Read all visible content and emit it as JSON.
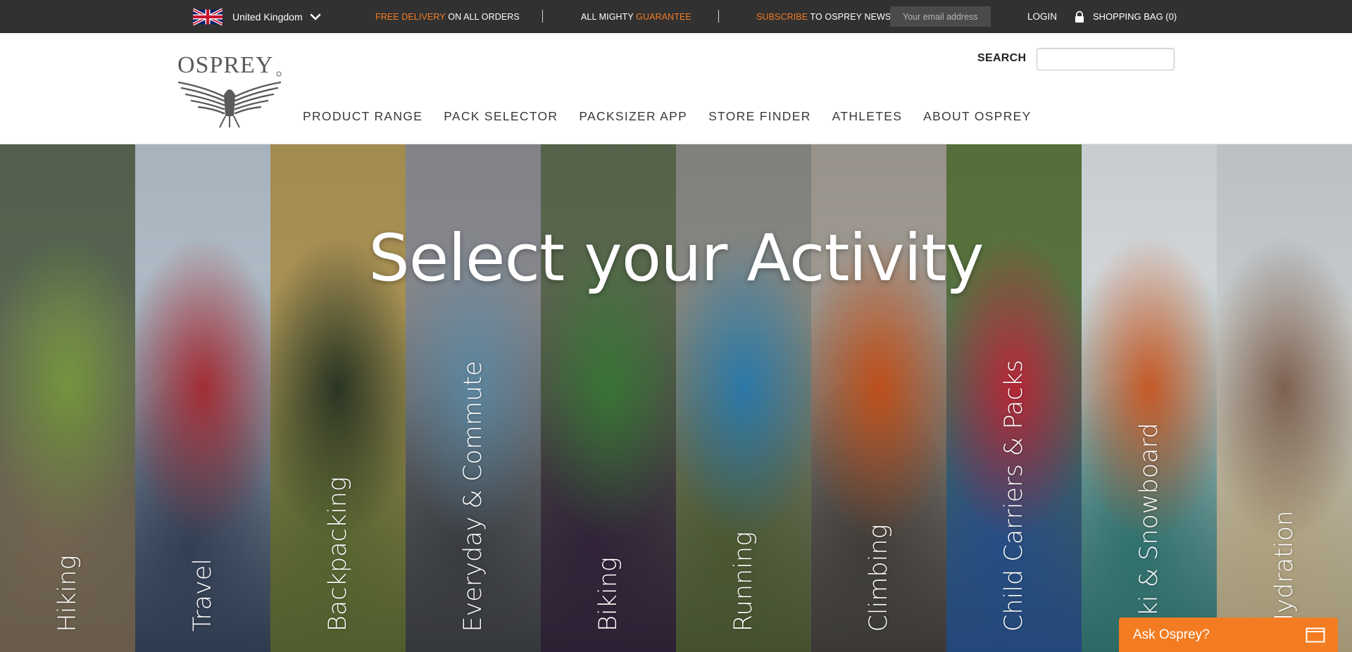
{
  "topbar": {
    "country": "United Kingdom",
    "promo1_highlight": "FREE DELIVERY",
    "promo1_rest": " ON ALL ORDERS",
    "promo2_text": "ALL MIGHTY ",
    "promo2_highlight": "GUARANTEE",
    "promo3_highlight": "SUBSCRIBE",
    "promo3_rest": " TO OSPREY NEWS",
    "email_placeholder": "Your email address",
    "login": "LOGIN",
    "bag": "SHOPPING BAG (0)"
  },
  "header": {
    "search_label": "SEARCH",
    "nav": [
      "PRODUCT RANGE",
      "PACK SELECTOR",
      "PACKSIZER APP",
      "STORE FINDER",
      "ATHLETES",
      "ABOUT OSPREY"
    ]
  },
  "hero": {
    "title": "Select your Activity",
    "activities": [
      {
        "label": "Hiking",
        "c1": "#5b6a55",
        "c2": "#7fa344",
        "c3": "#8c7a63"
      },
      {
        "label": "Travel",
        "c1": "#b9c7d2",
        "c2": "#b2313a",
        "c3": "#3d4e68"
      },
      {
        "label": "Backpacking",
        "c1": "#b49a5a",
        "c2": "#2e3a26",
        "c3": "#6a7b3c"
      },
      {
        "label": "Everyday & Commute",
        "c1": "#8f9196",
        "c2": "#6592ad",
        "c3": "#474a4f"
      },
      {
        "label": "Biking",
        "c1": "#5f6d52",
        "c2": "#3e7f3b",
        "c3": "#3c2a45"
      },
      {
        "label": "Running",
        "c1": "#8d8f8a",
        "c2": "#2f84b8",
        "c3": "#5b6b3c"
      },
      {
        "label": "Climbing",
        "c1": "#a9a39a",
        "c2": "#d0571d",
        "c3": "#4e4b47"
      },
      {
        "label": "Child Carriers & Packs",
        "c1": "#5e7a42",
        "c2": "#c72b3c",
        "c3": "#2e5fa3"
      },
      {
        "label": "Ski & Snowboard",
        "c1": "#dfe3e6",
        "c2": "#d9622a",
        "c3": "#3a8a86"
      },
      {
        "label": "Hydration",
        "c1": "#cfd5d9",
        "c2": "#8a6b5a",
        "c3": "#d6c69b"
      }
    ]
  },
  "chat": {
    "label": "Ask Osprey?"
  },
  "colors": {
    "accent": "#f37c22",
    "topbar_bg": "#313131"
  },
  "icons": [
    "uk-flag-icon",
    "chevron-down-icon",
    "lock-icon",
    "osprey-logo",
    "chat-window-icon"
  ]
}
